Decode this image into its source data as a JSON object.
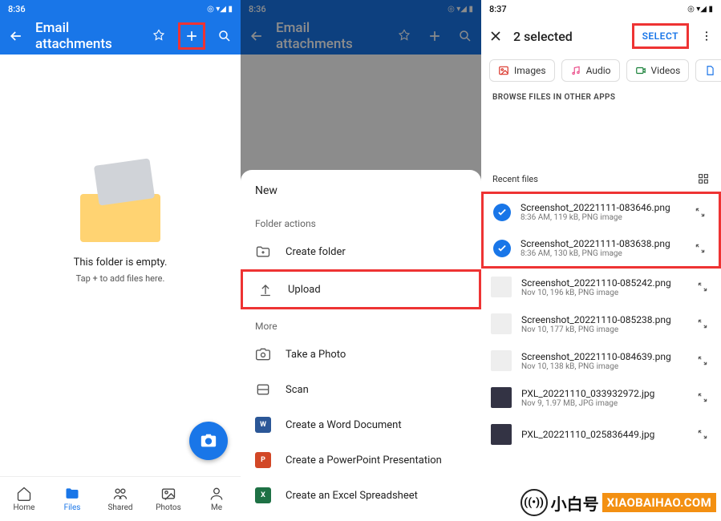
{
  "watermark_text": "XIAOBAIHAO.COM",
  "brand": {
    "cn": "小白号",
    "en": "XIAOBAIHAO.COM"
  },
  "screen1": {
    "time": "8:36",
    "title": "Email attachments",
    "empty_title": "This folder is empty.",
    "empty_sub": "Tap + to add files here.",
    "nav": {
      "home": "Home",
      "files": "Files",
      "shared": "Shared",
      "photos": "Photos",
      "me": "Me"
    }
  },
  "screen2": {
    "time": "8:36",
    "title": "Email attachments",
    "menu": {
      "new": "New",
      "folder_actions": "Folder actions",
      "create_folder": "Create folder",
      "upload": "Upload",
      "more": "More",
      "take_photo": "Take a Photo",
      "scan": "Scan",
      "word": "Create a Word Document",
      "ppt": "Create a PowerPoint Presentation",
      "excel": "Create an Excel Spreadsheet"
    }
  },
  "screen3": {
    "time": "8:37",
    "selected_title": "2 selected",
    "select_btn": "SELECT",
    "chips": {
      "images": "Images",
      "audio": "Audio",
      "videos": "Videos",
      "documents": "Documents"
    },
    "browse_label": "BROWSE FILES IN OTHER APPS",
    "recent_label": "Recent files",
    "files": [
      {
        "name": "Screenshot_20221111-083646.png",
        "detail": "8:36 AM, 119 kB, PNG image",
        "selected": true
      },
      {
        "name": "Screenshot_20221111-083638.png",
        "detail": "8:36 AM, 130 kB, PNG image",
        "selected": true
      },
      {
        "name": "Screenshot_20221110-085242.png",
        "detail": "Nov 10, 196 kB, PNG image",
        "selected": false
      },
      {
        "name": "Screenshot_20221110-085238.png",
        "detail": "Nov 10, 177 kB, PNG image",
        "selected": false
      },
      {
        "name": "Screenshot_20221110-084639.png",
        "detail": "Nov 10, 138 kB, PNG image",
        "selected": false
      },
      {
        "name": "PXL_20221110_033932972.jpg",
        "detail": "Nov 9, 1.97 MB, JPG image",
        "selected": false
      },
      {
        "name": "PXL_20221110_025836449.jpg",
        "detail": "",
        "selected": false
      }
    ]
  }
}
